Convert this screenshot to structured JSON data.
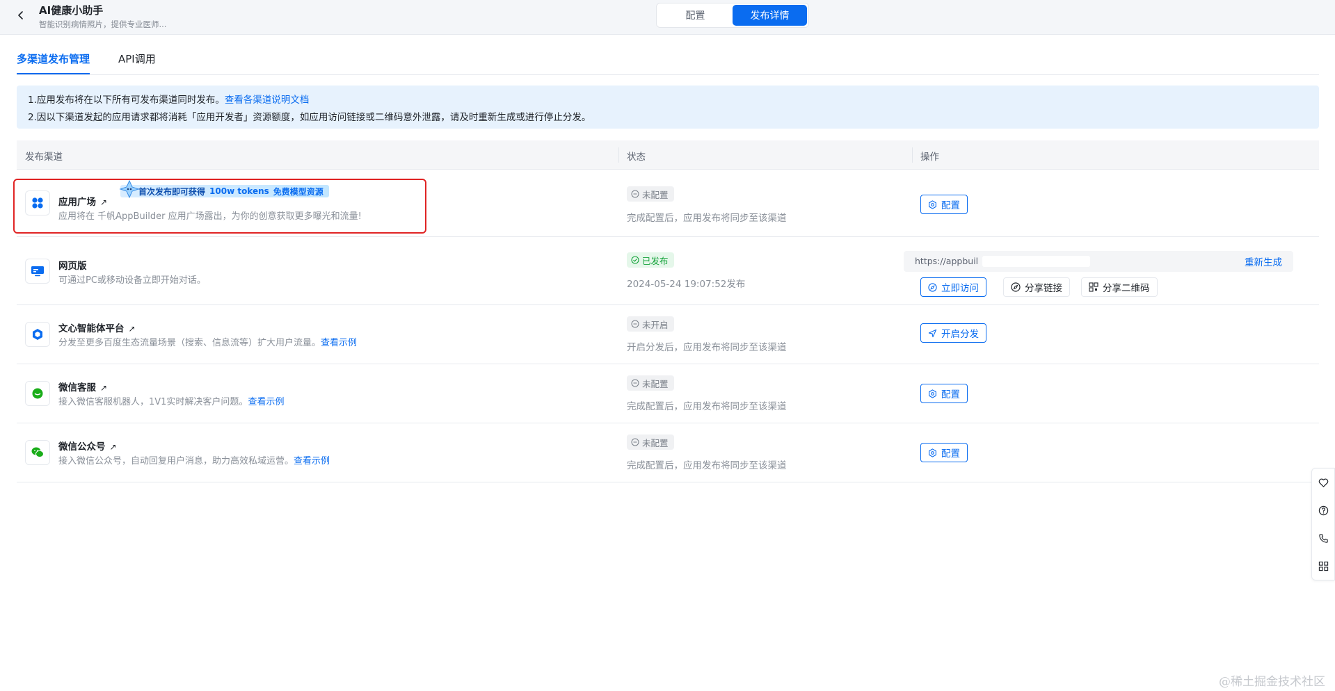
{
  "header": {
    "title": "AI健康小助手",
    "subtitle": "智能识别病情照片，提供专业医师...",
    "segments": [
      "配置",
      "发布详情"
    ]
  },
  "tabs": [
    "多渠道发布管理",
    "API调用"
  ],
  "notice": {
    "line1": "1.应用发布将在以下所有可发布渠道同时发布。",
    "line1_link": "查看各渠道说明文档",
    "line2": "2.因以下渠道发起的应用请求都将消耗「应用开发者」资源额度，如应用访问链接或二维码意外泄露，请及时重新生成或进行停止分发。"
  },
  "table": {
    "columns": [
      "发布渠道",
      "状态",
      "操作"
    ]
  },
  "promo": {
    "text": "首次发布即可获得",
    "highlight": "100w tokens",
    "suffix": "免费模型资源"
  },
  "rows": [
    {
      "name": "应用广场",
      "desc": "应用将在 千帆AppBuilder 应用广场露出，为你的创意获取更多曝光和流量!",
      "status": "未配置",
      "status_text": "完成配置后，应用发布将同步至该渠道",
      "action": "配置"
    },
    {
      "name": "网页版",
      "desc": "可通过PC或移动设备立即开始对话。",
      "status": "已发布",
      "status_text": "2024-05-24 19:07:52发布",
      "url": "https://appbuil",
      "regenerate": "重新生成",
      "actions": [
        "立即访问",
        "分享链接",
        "分享二维码"
      ]
    },
    {
      "name": "文心智能体平台",
      "desc": "分发至更多百度生态流量场景（搜索、信息流等）扩大用户流量。",
      "desc_link": "查看示例",
      "status": "未开启",
      "status_text": "开启分发后，应用发布将同步至该渠道",
      "action": "开启分发"
    },
    {
      "name": "微信客服",
      "desc": "接入微信客服机器人，1V1实时解决客户问题。",
      "desc_link": "查看示例",
      "status": "未配置",
      "status_text": "完成配置后，应用发布将同步至该渠道",
      "action": "配置"
    },
    {
      "name": "微信公众号",
      "desc": "接入微信公众号，自动回复用户消息，助力高效私域运营。",
      "desc_link": "查看示例",
      "status": "未配置",
      "status_text": "完成配置后，应用发布将同步至该渠道",
      "action": "配置"
    }
  ],
  "floating_icons": [
    "heart-icon",
    "help-icon",
    "phone-icon",
    "apps-grid-icon"
  ],
  "watermark": "@稀土掘金技术社区",
  "colors": {
    "primary": "#0a6cf0",
    "success": "#15a33a",
    "highlight_border": "#e02424",
    "notice_bg": "#e7f2fd"
  }
}
